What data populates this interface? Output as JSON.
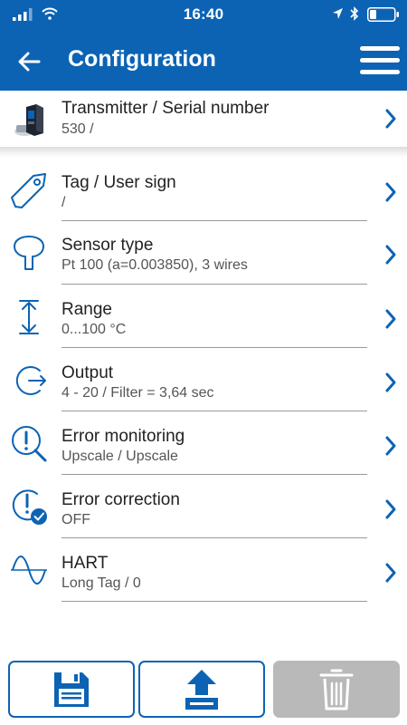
{
  "status_bar": {
    "time": "16:40"
  },
  "header": {
    "title": "Configuration"
  },
  "colors": {
    "accent": "#0c63b4",
    "disabled": "#b9b9b9"
  },
  "transmitter": {
    "title": "Transmitter / Serial number",
    "value": "530 /"
  },
  "rows": [
    {
      "icon": "tag-icon",
      "title": "Tag / User sign",
      "value": " /"
    },
    {
      "icon": "sensor-icon",
      "title": "Sensor type",
      "value": "Pt 100 (a=0.003850), 3 wires"
    },
    {
      "icon": "range-icon",
      "title": "Range",
      "value": "0...100 °C"
    },
    {
      "icon": "output-icon",
      "title": "Output",
      "value": "4 - 20 / Filter = 3,64 sec"
    },
    {
      "icon": "error-monitoring-icon",
      "title": "Error monitoring",
      "value": "Upscale / Upscale"
    },
    {
      "icon": "error-correction-icon",
      "title": "Error correction",
      "value": "OFF"
    },
    {
      "icon": "hart-icon",
      "title": "HART",
      "value": "Long Tag / 0"
    }
  ],
  "toolbar": {
    "save": {
      "icon": "floppy-disk-icon",
      "enabled": true
    },
    "upload": {
      "icon": "upload-icon",
      "enabled": true
    },
    "delete": {
      "icon": "trash-icon",
      "enabled": false
    }
  }
}
